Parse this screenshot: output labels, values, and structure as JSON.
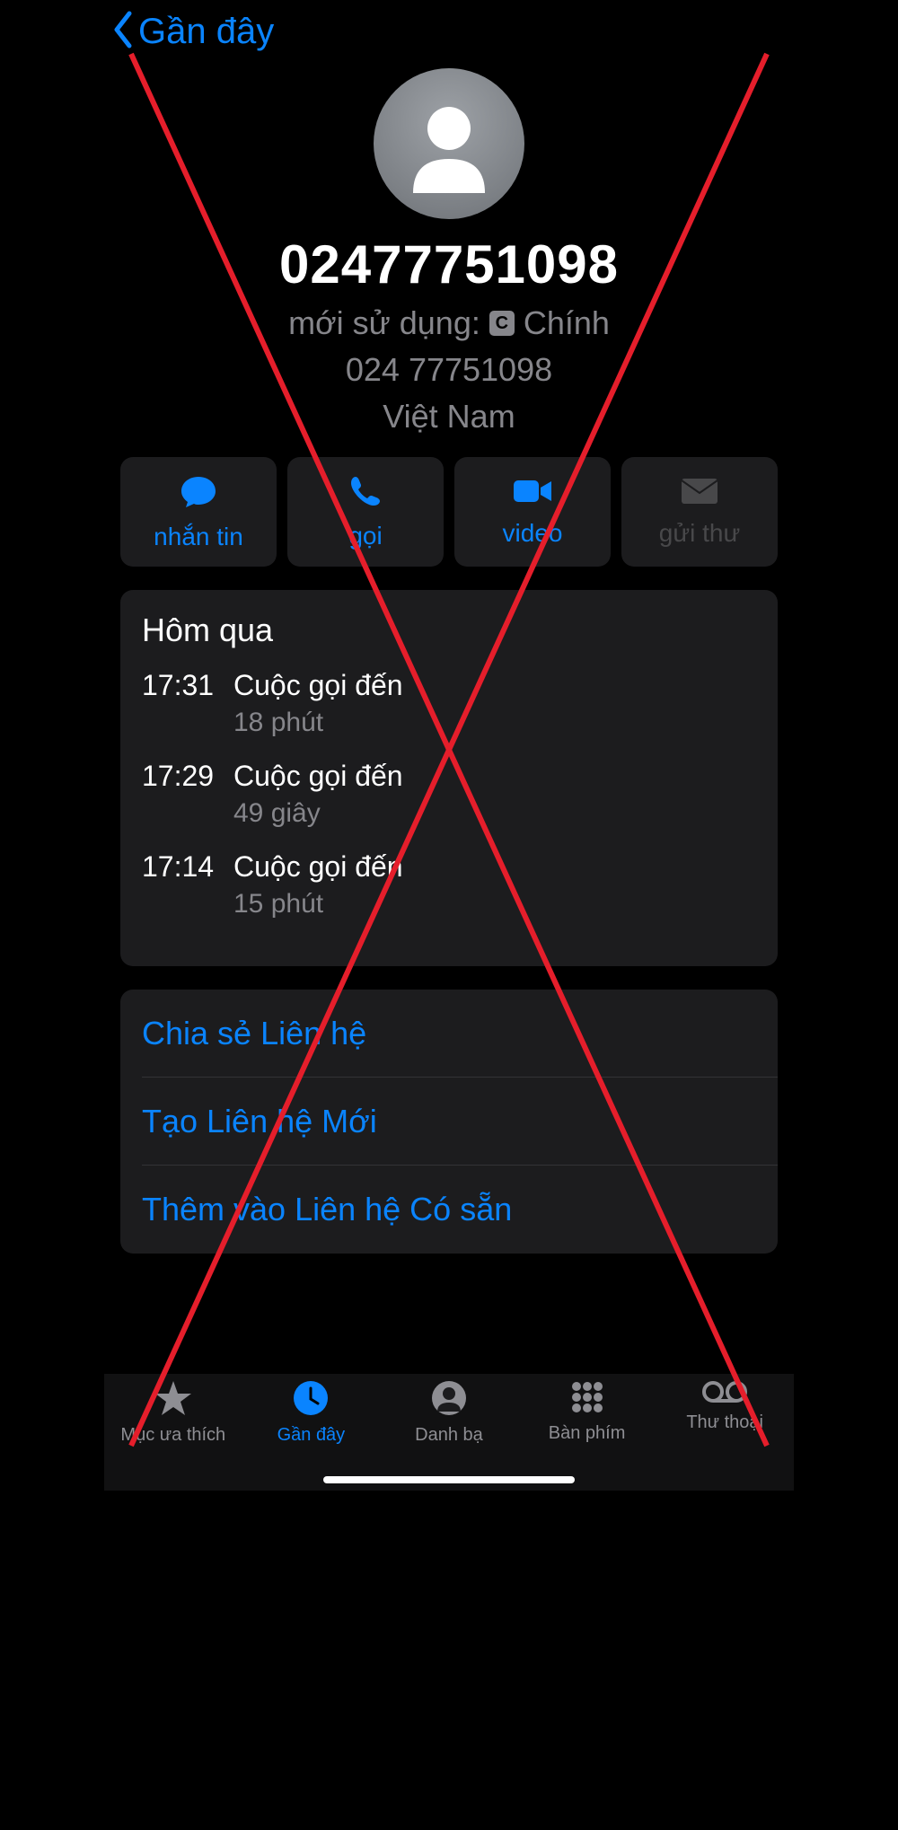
{
  "colors": {
    "accent": "#0a84ff",
    "muted": "#86868b",
    "panel": "#1c1c1e",
    "red": "#e51e2b"
  },
  "navbar": {
    "back_label": "Gần đây"
  },
  "contact": {
    "phone_display": "02477751098",
    "recently_prefix": "mới sử dụng:",
    "sim_badge": "C",
    "sim_name": "Chính",
    "phone_formatted": "024 77751098",
    "region": "Việt Nam"
  },
  "actions": [
    {
      "id": "message",
      "label": "nhắn tin",
      "icon": "message-icon",
      "enabled": true
    },
    {
      "id": "call",
      "label": "gọi",
      "icon": "phone-icon",
      "enabled": true
    },
    {
      "id": "video",
      "label": "video",
      "icon": "video-icon",
      "enabled": true
    },
    {
      "id": "mail",
      "label": "gửi thư",
      "icon": "mail-icon",
      "enabled": false
    }
  ],
  "history": {
    "section_title": "Hôm qua",
    "calls": [
      {
        "time": "17:31",
        "type": "Cuộc gọi đến",
        "duration": "18 phút"
      },
      {
        "time": "17:29",
        "type": "Cuộc gọi đến",
        "duration": "49 giây"
      },
      {
        "time": "17:14",
        "type": "Cuộc gọi đến",
        "duration": "15 phút"
      }
    ]
  },
  "options": [
    "Chia sẻ Liên hệ",
    "Tạo Liên hệ Mới",
    "Thêm vào Liên hệ Có sẵn"
  ],
  "tabs": [
    {
      "id": "favorites",
      "label": "Mục ưa thích",
      "active": false
    },
    {
      "id": "recents",
      "label": "Gần đây",
      "active": true
    },
    {
      "id": "contacts",
      "label": "Danh bạ",
      "active": false
    },
    {
      "id": "keypad",
      "label": "Bàn phím",
      "active": false
    },
    {
      "id": "voicemail",
      "label": "Thư thoại",
      "active": false
    }
  ],
  "overlay": {
    "red_x": true
  }
}
